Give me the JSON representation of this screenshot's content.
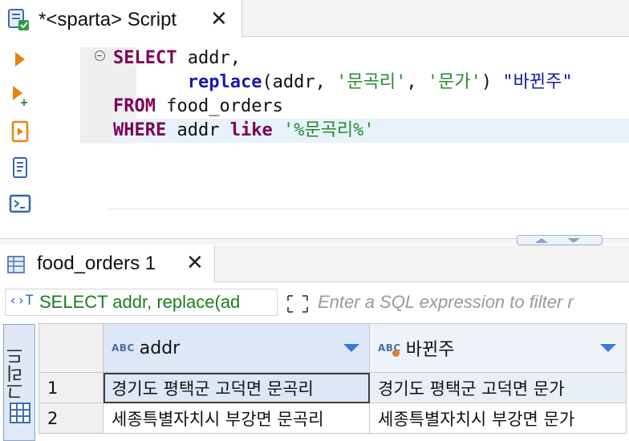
{
  "editor_tab": {
    "title": "*<sparta> Script",
    "close": "✕"
  },
  "sql": {
    "line1": {
      "kw": "SELECT",
      "rest": " addr,"
    },
    "line2": {
      "indent": "       ",
      "fn": "replace",
      "p1": "(addr, ",
      "s1": "'문곡리'",
      "comma": ", ",
      "s2": "'문가'",
      "p2": ") ",
      "alias": "\"바뀐주\""
    },
    "line3": {
      "kw": "FROM",
      "rest": " food_orders"
    },
    "line4": {
      "kw": "WHERE",
      "rest": " addr ",
      "kw2": "like",
      "sp": " ",
      "s": "'%문곡리%'"
    }
  },
  "result_tab": {
    "title": "food_orders 1",
    "close": "✕"
  },
  "filter": {
    "sql_icon": "‹›T",
    "sql_text": "SELECT addr, replace(ad",
    "placeholder": "Enter a SQL expression to filter r"
  },
  "vertical_tab": {
    "label": "그리드"
  },
  "grid": {
    "type_badge": "ABC",
    "columns": [
      {
        "name": "addr"
      },
      {
        "name": "바뀐주"
      }
    ],
    "rows": [
      {
        "num": "1",
        "addr": "경기도 평택군 고덕면 문곡리",
        "changed": "경기도 평택군 고덕면 문가"
      },
      {
        "num": "2",
        "addr": "세종특별자치시 부강면 문곡리",
        "changed": "세종특별자치시 부강면 문가"
      }
    ]
  },
  "icons": {
    "tab": "script-connection-icon",
    "toolbar": [
      "execute-statement-icon",
      "execute-in-new-tab-icon",
      "execute-script-icon",
      "explain-plan-icon",
      "terminal-icon"
    ]
  },
  "colors": {
    "keyword": "#7f0055",
    "string": "#2a8a2a",
    "identifier": "#1a1aa6",
    "accent": "#3a7bd5",
    "header_bg": "#dde8f6"
  }
}
